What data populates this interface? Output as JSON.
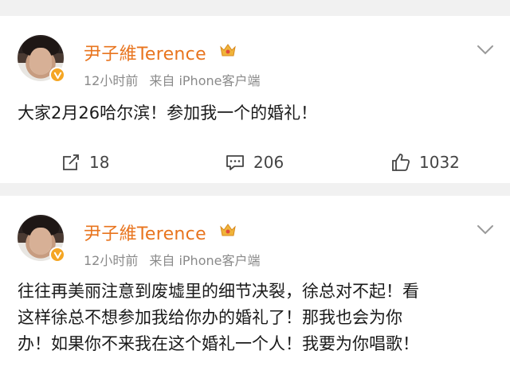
{
  "posts": [
    {
      "author": "尹子維Terence",
      "time": "12小时前",
      "source": "来自 iPhone客户端",
      "text": "大家2月26哈尔滨！参加我一个的婚礼！",
      "repost_count": "18",
      "comment_count": "206",
      "like_count": "1032"
    },
    {
      "author": "尹子維Terence",
      "time": "12小时前",
      "source": "来自 iPhone客户端",
      "text_lines": [
        "往往再美丽注意到废墟里的细节决裂，徐总对不起！看",
        "这样徐总不想参加我给你办的婚礼了！那我也会为你",
        "办！如果你不来我在这个婚礼一个人！我要为你唱歌！"
      ]
    }
  ],
  "colors": {
    "author": "#e8741e",
    "meta": "#8a8a8a",
    "verified_badge": "#f5a623",
    "background": "#f1f1f1"
  },
  "icons": [
    "verified-v-icon",
    "crown-icon",
    "chevron-down-icon",
    "repost-icon",
    "comment-icon",
    "like-icon"
  ]
}
